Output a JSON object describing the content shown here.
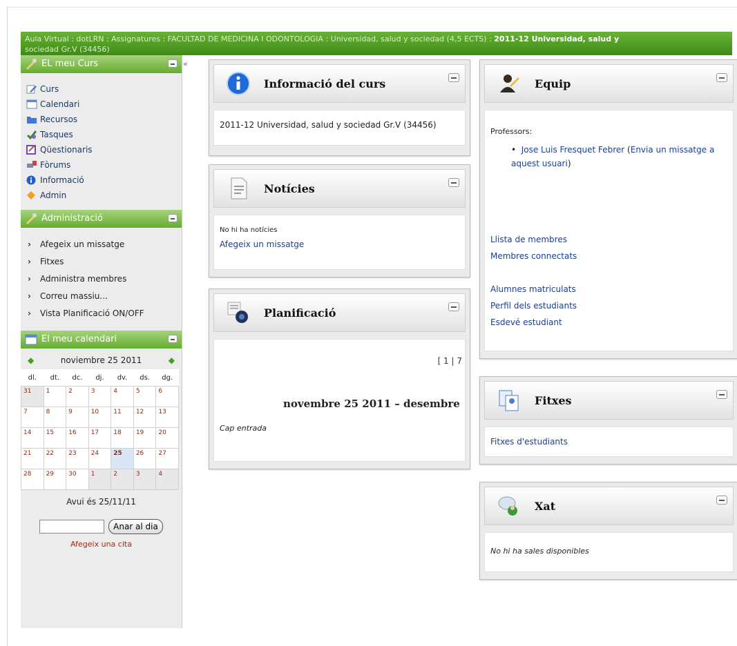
{
  "breadcrumb": {
    "text": "Aula Virtual : dotLRN : Assignatures : FACULTAD DE MEDICINA I ODONTOLOGIA : Universidad, salud y sociedad (4,5 ECTS) : ",
    "last": "2011-12 Universidad, salud y",
    "wrap": "sociedad Gr.V (34456)"
  },
  "sidebar": {
    "collapse_label": "«",
    "course_title": "EL meu Curs",
    "course_items": [
      {
        "label": "Curs",
        "icon": "pencil-icon"
      },
      {
        "label": "Calendari",
        "icon": "calendar-icon"
      },
      {
        "label": "Recursos",
        "icon": "folder-icon"
      },
      {
        "label": "Tasques",
        "icon": "tasks-icon"
      },
      {
        "label": "Qüestionaris",
        "icon": "questionnaire-icon"
      },
      {
        "label": "Fòrums",
        "icon": "forum-icon"
      },
      {
        "label": "Informació",
        "icon": "info-icon"
      },
      {
        "label": "Admin",
        "icon": "admin-icon"
      }
    ],
    "admin_title": "Administració",
    "admin_items": [
      "Afegeix un missatge",
      "Fitxes",
      "Administra membres",
      "Correu massiu...",
      "Vista Planificació ON/OFF"
    ],
    "calendar_title": "El meu calendari",
    "calendar": {
      "month_label": "noviembre 25 2011",
      "weekdays": [
        "dl.",
        "dt.",
        "dc.",
        "dj.",
        "dv.",
        "ds.",
        "dg."
      ],
      "weeks": [
        [
          "31",
          "1",
          "2",
          "3",
          "4",
          "5",
          "6"
        ],
        [
          "7",
          "8",
          "9",
          "10",
          "11",
          "12",
          "13"
        ],
        [
          "14",
          "15",
          "16",
          "17",
          "18",
          "19",
          "20"
        ],
        [
          "21",
          "22",
          "23",
          "24",
          "25",
          "26",
          "27"
        ],
        [
          "28",
          "29",
          "30",
          "1",
          "2",
          "3",
          "4"
        ]
      ],
      "today_day": "25",
      "today_text": "Avui és 25/11/11",
      "goto_button": "Anar al dia",
      "goto_value": "",
      "add_appointment": "Afegeix una cita"
    }
  },
  "info_portlet": {
    "title": "Informació del curs",
    "text": "2011-12 Universidad, salud y sociedad Gr.V (34456)"
  },
  "news_portlet": {
    "title": "Notícies",
    "empty": "No hi ha notícies",
    "add_link": "Afegeix un missatge"
  },
  "planning_portlet": {
    "title": "Planificació",
    "pager": "[ 1 | 7",
    "range": "novembre 25 2011 – desembre",
    "empty": "Cap entrada"
  },
  "team_portlet": {
    "title": "Equip",
    "professors_label": "Professors:",
    "professor_name": "Jose Luis Fresquet Febrer",
    "professor_message_open": " (",
    "professor_message": "Envia un missatge a aquest usuari",
    "professor_message_close": ")",
    "links_a": [
      "Llista de membres",
      "Membres connectats"
    ],
    "links_b": [
      "Alumnes matriculats",
      "Perfil dels estudiants",
      "Esdevé estudiant"
    ]
  },
  "files_portlet": {
    "title": "Fitxes",
    "link": "Fitxes d'estudiants"
  },
  "chat_portlet": {
    "title": "Xat",
    "empty": "No hi ha sales disponibles"
  }
}
